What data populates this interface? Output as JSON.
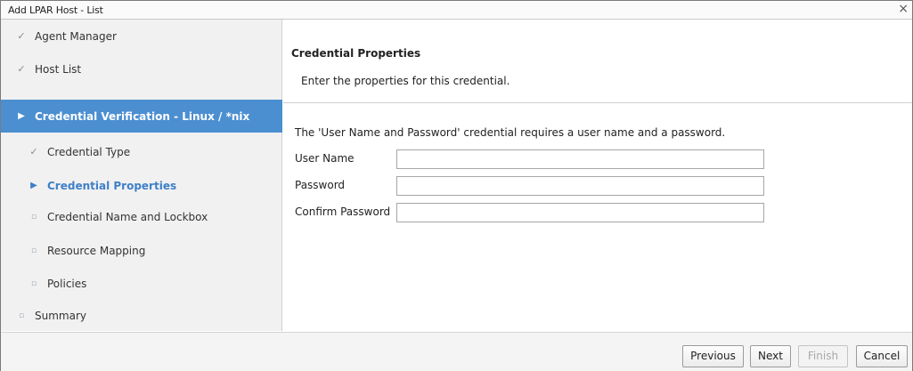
{
  "window": {
    "title": "Add LPAR Host - List",
    "close_glyph": "×"
  },
  "sidebar": {
    "steps": [
      {
        "label": "Agent Manager",
        "state": "done",
        "icon": "checkmark-icon",
        "glyph": "✓"
      },
      {
        "label": "Host List",
        "state": "done",
        "icon": "checkmark-icon",
        "glyph": "✓"
      },
      {
        "label": "Credential Verification - Linux / *nix",
        "state": "active",
        "icon": "arrow-right-icon",
        "glyph": "▶"
      },
      {
        "label": "Credential Type",
        "state": "done",
        "icon": "checkmark-icon",
        "glyph": "✓"
      },
      {
        "label": "Credential Properties",
        "state": "current",
        "icon": "arrow-right-icon",
        "glyph": "▶"
      },
      {
        "label": "Credential Name and Lockbox",
        "state": "pending",
        "icon": "bullet-icon",
        "glyph": "▫"
      },
      {
        "label": "Resource Mapping",
        "state": "pending",
        "icon": "bullet-icon",
        "glyph": "▫"
      },
      {
        "label": "Policies",
        "state": "pending",
        "icon": "bullet-icon",
        "glyph": "▫"
      },
      {
        "label": "Summary",
        "state": "pending",
        "icon": "bullet-icon",
        "glyph": "▫"
      }
    ]
  },
  "main": {
    "title": "Credential Properties",
    "subtitle": "Enter the properties for this credential.",
    "description": "The 'User Name and Password' credential requires a user name and a password.",
    "fields": {
      "username": {
        "label": "User Name",
        "value": ""
      },
      "password": {
        "label": "Password",
        "value": ""
      },
      "confirm": {
        "label": "Confirm Password",
        "value": ""
      }
    }
  },
  "footer": {
    "previous": "Previous",
    "next": "Next",
    "finish": "Finish",
    "cancel": "Cancel"
  },
  "colors": {
    "active_bg": "#4b8fd1",
    "current_text": "#3f7fc8"
  }
}
